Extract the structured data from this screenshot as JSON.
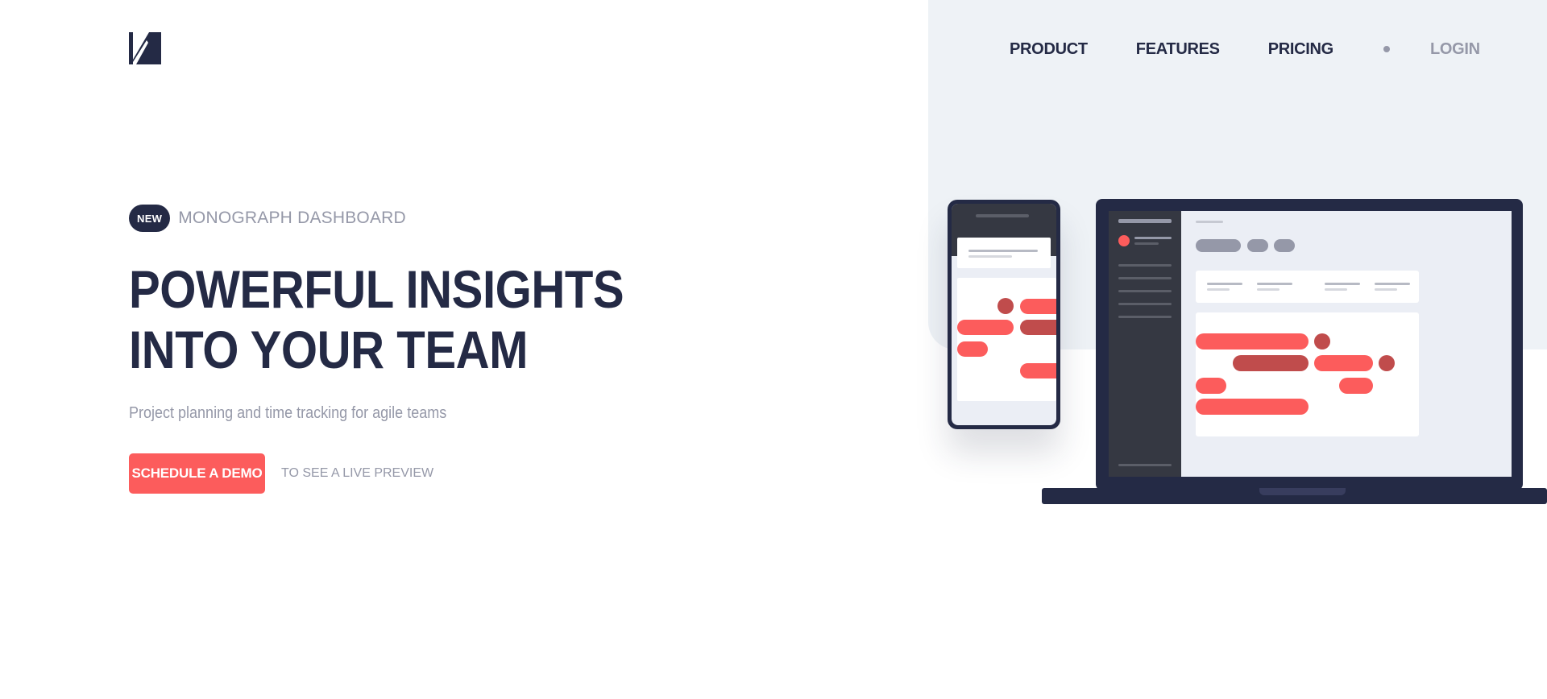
{
  "brand": {
    "logo": "monograph-logo"
  },
  "nav": {
    "items": [
      {
        "label": "PRODUCT"
      },
      {
        "label": "FEATURES"
      },
      {
        "label": "PRICING"
      }
    ],
    "login": "LOGIN"
  },
  "hero": {
    "badge": "NEW",
    "badge_text": "MONOGRAPH DASHBOARD",
    "title_line1": "POWERFUL INSIGHTS",
    "title_line2": "INTO YOUR TEAM",
    "subtitle": "Project planning and time tracking for agile teams",
    "cta_label": "SCHEDULE A DEMO",
    "cta_note": "TO SEE A LIVE PREVIEW"
  },
  "colors": {
    "accent": "#fc5c5c",
    "accent_dark": "#c04c4c",
    "navy": "#242a45",
    "grey": "#9598a8",
    "panel": "#eef2f6"
  }
}
